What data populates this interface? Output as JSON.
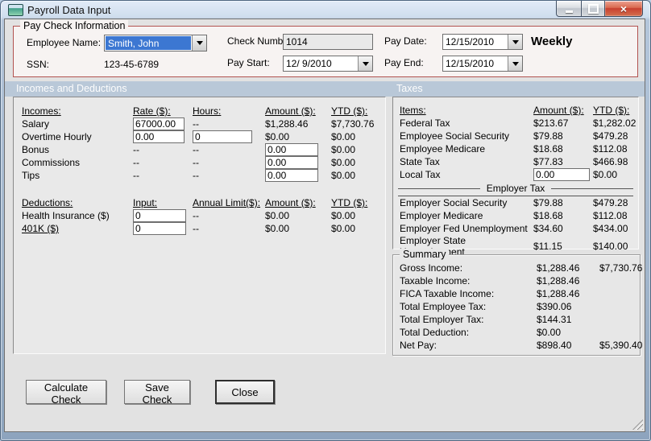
{
  "colors": {
    "accent_red": "#b25350",
    "band_blue": "#b9c8d8",
    "selection_blue": "#3c77d2",
    "close_red": "#c8402f"
  },
  "window": {
    "title": "Payroll Data Input"
  },
  "paycheck": {
    "legend": "Pay Check Information",
    "employee_name_label": "Employee Name:",
    "employee_name_value": "Smith, John",
    "ssn_label": "SSN:",
    "ssn_value": "123-45-6789",
    "check_number_label": "Check Number:",
    "check_number_value": "1014",
    "pay_start_label": "Pay Start:",
    "pay_start_value": "12/ 9/2010",
    "pay_date_label": "Pay Date:",
    "pay_date_value": "12/15/2010",
    "pay_end_label": "Pay End:",
    "pay_end_value": "12/15/2010",
    "frequency": "Weekly"
  },
  "bands": {
    "incomes": "Incomes and Deductions",
    "taxes": "Taxes"
  },
  "incomes": {
    "headers": [
      "Incomes:",
      "Rate ($):",
      "Hours:",
      "Amount ($):",
      "YTD ($):"
    ],
    "rows": [
      {
        "label": "Salary",
        "rate": "67000.00",
        "hours": "--",
        "amount": "$1,288.46",
        "ytd": "$7,730.76"
      },
      {
        "label": "Overtime Hourly",
        "rate": "0.00",
        "hours": "0",
        "amount": "$0.00",
        "ytd": "$0.00"
      },
      {
        "label": "Bonus",
        "rate": "--",
        "hours": "--",
        "amount": "0.00",
        "ytd": "$0.00"
      },
      {
        "label": "Commissions",
        "rate": "--",
        "hours": "--",
        "amount": "0.00",
        "ytd": "$0.00"
      },
      {
        "label": "Tips",
        "rate": "--",
        "hours": "--",
        "amount": "0.00",
        "ytd": "$0.00"
      }
    ]
  },
  "deductions": {
    "headers": [
      "Deductions:",
      "Input:",
      "Annual Limit($):",
      "Amount ($):",
      "YTD ($):"
    ],
    "rows": [
      {
        "label": "Health Insurance  ($)",
        "input": "0",
        "limit": "--",
        "amount": "$0.00",
        "ytd": "$0.00"
      },
      {
        "label": "401K  ($)",
        "input": "0",
        "limit": "--",
        "amount": "$0.00",
        "ytd": "$0.00"
      }
    ]
  },
  "taxes": {
    "headers": [
      "Items:",
      "Amount ($):",
      "YTD ($):"
    ],
    "employee_rows": [
      {
        "label": "Federal Tax",
        "amount": "$213.67",
        "ytd": "$1,282.02"
      },
      {
        "label": "Employee Social Security",
        "amount": "$79.88",
        "ytd": "$479.28"
      },
      {
        "label": "Employee Medicare",
        "amount": "$18.68",
        "ytd": "$112.08"
      },
      {
        "label": "State Tax",
        "amount": "$77.83",
        "ytd": "$466.98"
      },
      {
        "label": "Local Tax",
        "amount": "0.00",
        "ytd": "$0.00"
      }
    ],
    "employer_header": "Employer Tax",
    "employer_rows": [
      {
        "label": "Employer Social Security",
        "amount": "$79.88",
        "ytd": "$479.28"
      },
      {
        "label": "Employer Medicare",
        "amount": "$18.68",
        "ytd": "$112.08"
      },
      {
        "label": "Employer Fed Unemployment",
        "amount": "$34.60",
        "ytd": "$434.00"
      },
      {
        "label": "Employer State Unemployment",
        "amount": "$11.15",
        "ytd": "$140.00"
      }
    ]
  },
  "summary": {
    "legend": "Summary",
    "rows": [
      {
        "label": "Gross Income:",
        "amount": "$1,288.46",
        "ytd": "$7,730.76"
      },
      {
        "label": "Taxable Income:",
        "amount": "$1,288.46",
        "ytd": ""
      },
      {
        "label": "FICA Taxable Income:",
        "amount": "$1,288.46",
        "ytd": ""
      },
      {
        "label": "Total Employee Tax:",
        "amount": "$390.06",
        "ytd": ""
      },
      {
        "label": "Total Employer Tax:",
        "amount": "$144.31",
        "ytd": ""
      },
      {
        "label": "Total Deduction:",
        "amount": "$0.00",
        "ytd": ""
      },
      {
        "label": "Net Pay:",
        "amount": "$898.40",
        "ytd": "$5,390.40"
      }
    ]
  },
  "buttons": {
    "calculate": "Calculate Check",
    "save": "Save Check",
    "close": "Close"
  }
}
